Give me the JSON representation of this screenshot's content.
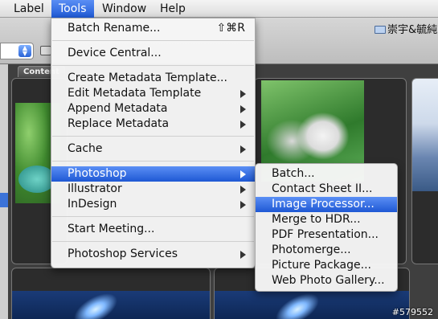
{
  "menubar": {
    "items": [
      "Label",
      "Tools",
      "Window",
      "Help"
    ]
  },
  "toolbar": {
    "folder_path": "崇宇&毓純"
  },
  "content": {
    "tab_label": "Content"
  },
  "tools_menu": {
    "batch_rename": "Batch Rename...",
    "batch_rename_shortcut": "⇧⌘R",
    "device_central": "Device Central...",
    "create_metadata_template": "Create Metadata Template...",
    "edit_metadata_template": "Edit Metadata Template",
    "append_metadata": "Append Metadata",
    "replace_metadata": "Replace Metadata",
    "cache": "Cache",
    "photoshop": "Photoshop",
    "illustrator": "Illustrator",
    "indesign": "InDesign",
    "start_meeting": "Start Meeting...",
    "photoshop_services": "Photoshop Services"
  },
  "photoshop_submenu": {
    "items": [
      "Batch...",
      "Contact Sheet II...",
      "Image Processor...",
      "Merge to HDR...",
      "PDF Presentation...",
      "Photomerge...",
      "Picture Package...",
      "Web Photo Gallery..."
    ],
    "highlighted": "Image Processor..."
  },
  "watermark": "#579552",
  "colors": {
    "menu_highlight": "#2a63d9",
    "menubar_bg": "#e8e8e8"
  }
}
